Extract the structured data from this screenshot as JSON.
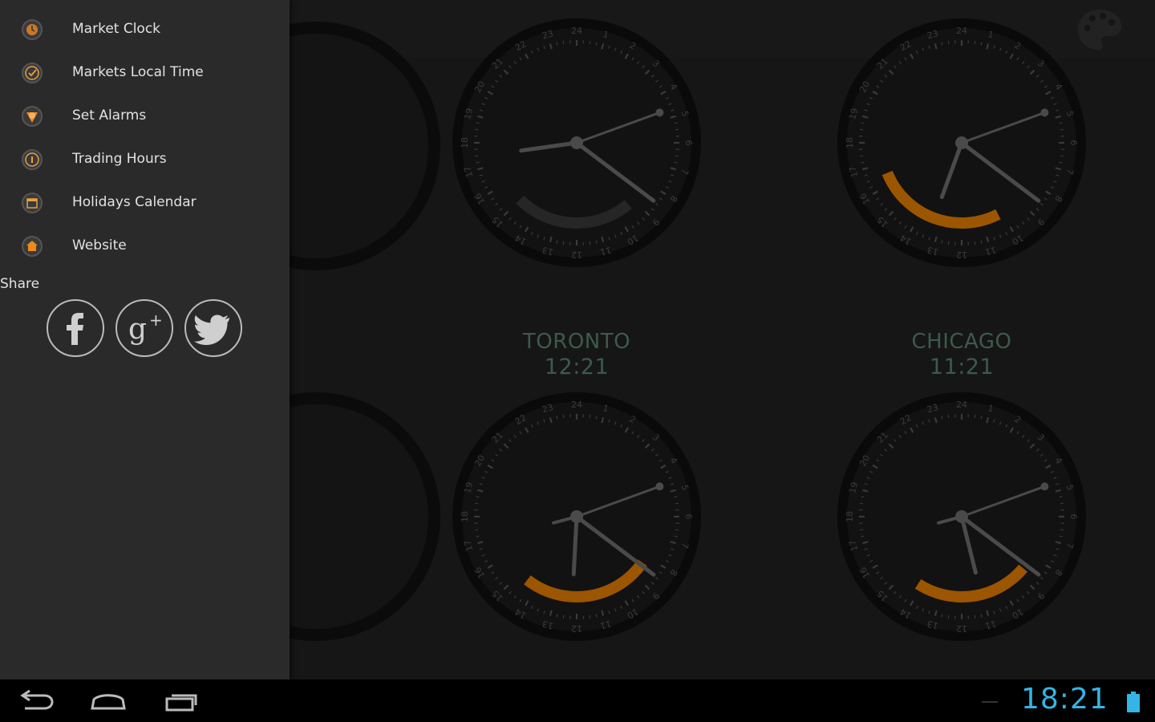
{
  "drawer": {
    "items": [
      {
        "label": "Market Clock",
        "icon": "market-clock-icon"
      },
      {
        "label": "Markets Local Time",
        "icon": "local-time-icon"
      },
      {
        "label": "Set Alarms",
        "icon": "alarm-icon"
      },
      {
        "label": "Trading Hours",
        "icon": "info-icon"
      },
      {
        "label": "Holidays Calendar",
        "icon": "calendar-icon"
      },
      {
        "label": "Website",
        "icon": "home-icon"
      }
    ],
    "share_label": "Share",
    "share_buttons": [
      "facebook-icon",
      "google-plus-icon",
      "twitter-icon"
    ]
  },
  "clocks": [
    {
      "city": "TORONTO",
      "time": "12:21"
    },
    {
      "city": "CHICAGO",
      "time": "11:21"
    }
  ],
  "system_bar": {
    "time": "18:21"
  },
  "colors": {
    "accent_orange": "#9c5500",
    "city_label": "#3d5a4c",
    "system_clock": "#33b5e5",
    "drawer_bg": "#2a2a2a"
  }
}
